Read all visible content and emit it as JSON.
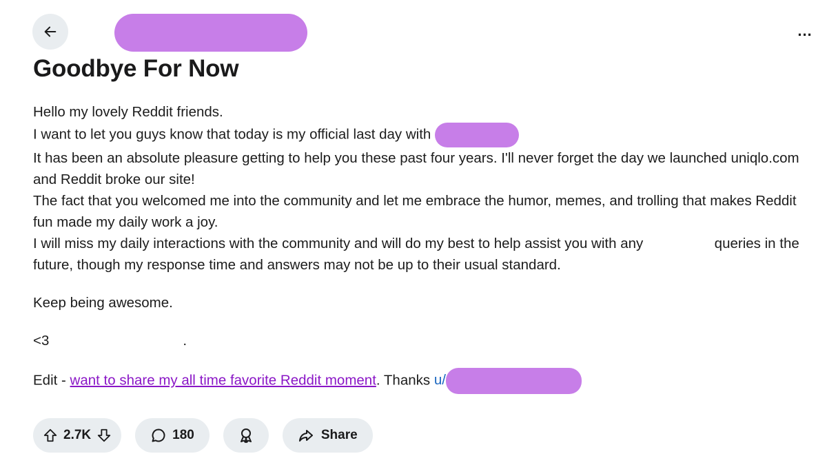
{
  "header": {
    "back_icon": "arrow-left-icon",
    "more_label": "..."
  },
  "post": {
    "title": "Goodbye For Now",
    "paragraphs": {
      "p1": "Hello my lovely Reddit friends.",
      "p2": "I want to let you guys know that today is my official last day with",
      "p3": "It has been an absolute pleasure getting to help you these past four years. I'll never forget the day we launched uniqlo.com and Reddit broke our site!",
      "p4": "The fact that you welcomed me into the community and let me embrace the humor, memes, and trolling that makes Reddit fun made my daily work a joy.",
      "p5_a": "I will miss my daily interactions with the community and will do my best to help assist you with any",
      "p5_b": "queries in the future, though my response time and answers may not be up to their usual standard.",
      "p6": "Keep being awesome.",
      "p7": "<3",
      "p7_dot": ".",
      "edit_prefix": "Edit - ",
      "edit_link": "want to share my all time favorite Reddit moment",
      "edit_suffix": ". Thanks ",
      "user_prefix": "u/"
    }
  },
  "actions": {
    "votes": "2.7K",
    "comments": "180",
    "share": "Share"
  },
  "colors": {
    "redaction": "#c77ee8",
    "link_visited": "#8a16c6",
    "user_link": "#1a66c0",
    "pill_bg": "#e9edf0"
  }
}
